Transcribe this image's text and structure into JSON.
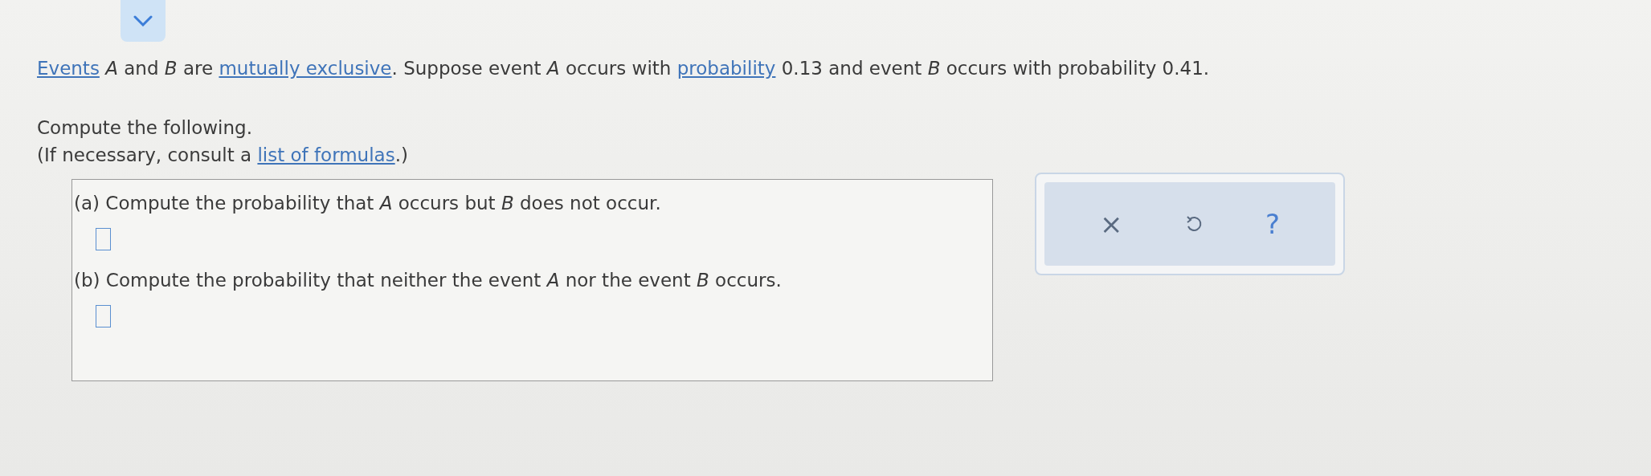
{
  "intro": [
    {
      "kind": "link",
      "text": "Events"
    },
    {
      "kind": "text",
      "text": " *A* and *B* are "
    },
    {
      "kind": "link",
      "text": "mutually exclusive"
    },
    {
      "kind": "text",
      "text": ". Suppose event *A* occurs with "
    },
    {
      "kind": "link",
      "text": "probability"
    },
    {
      "kind": "text",
      "text": " 0.13 and event *B* occurs with probability 0.41."
    }
  ],
  "instruction": "Compute the following.",
  "note": [
    {
      "kind": "text",
      "text": "(If necessary, consult a "
    },
    {
      "kind": "link",
      "text": "list of formulas"
    },
    {
      "kind": "text",
      "text": ".)"
    }
  ],
  "parts": [
    {
      "text": "(a) Compute the probability that *A* occurs but *B* does not occur."
    },
    {
      "text": "(b) Compute the probability that neither the event *A* nor the event *B* occurs."
    }
  ],
  "tools": {
    "clear": "×",
    "help": "?"
  }
}
